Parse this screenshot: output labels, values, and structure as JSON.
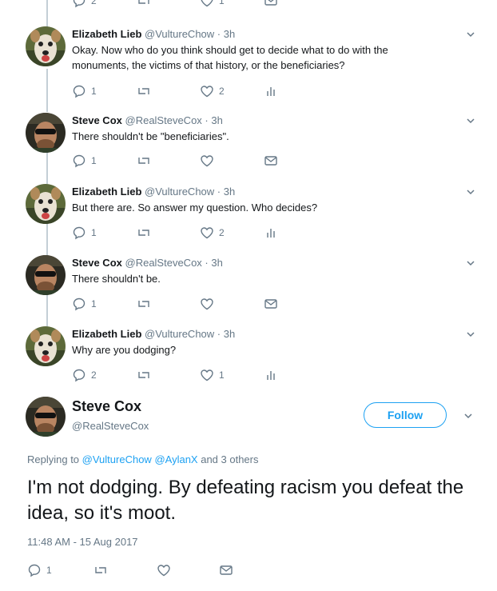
{
  "top_actions": {
    "reply_count": "2",
    "like_count": "1"
  },
  "tweets": [
    {
      "name": "Elizabeth Lieb",
      "handle": "@VultureChow",
      "time": "3h",
      "text": "Okay.  Now who do you think should get to decide what to do with the monuments, the victims of that history, or the beneficiaries?",
      "reply_count": "1",
      "like_count": "2",
      "avatar": "dog"
    },
    {
      "name": "Steve Cox",
      "handle": "@RealSteveCox",
      "time": "3h",
      "text": "There shouldn't be \"beneficiaries\".",
      "reply_count": "1",
      "like_count": "",
      "avatar": "man"
    },
    {
      "name": "Elizabeth Lieb",
      "handle": "@VultureChow",
      "time": "3h",
      "text": "But there are.  So answer my question.  Who decides?",
      "reply_count": "1",
      "like_count": "2",
      "avatar": "dog"
    },
    {
      "name": "Steve Cox",
      "handle": "@RealSteveCox",
      "time": "3h",
      "text": "There shouldn't be.",
      "reply_count": "1",
      "like_count": "",
      "avatar": "man"
    },
    {
      "name": "Elizabeth Lieb",
      "handle": "@VultureChow",
      "time": "3h",
      "text": "Why are you dodging?",
      "reply_count": "2",
      "like_count": "1",
      "avatar": "dog"
    }
  ],
  "main_tweet": {
    "name": "Steve Cox",
    "handle": "@RealSteveCox",
    "follow_label": "Follow",
    "replying_prefix": "Replying to",
    "mention1": "@VultureChow",
    "mention2": "@AylanX",
    "replying_suffix": "and 3 others",
    "text": "I'm not dodging. By defeating racism you defeat the idea, so it's moot.",
    "timestamp": "11:48 AM - 15 Aug 2017",
    "reply_count": "1"
  },
  "separator": "·",
  "colors": {
    "accent": "#1da1f2",
    "muted": "#657786",
    "text": "#14171a",
    "thread_line": "#c4cfd6"
  }
}
